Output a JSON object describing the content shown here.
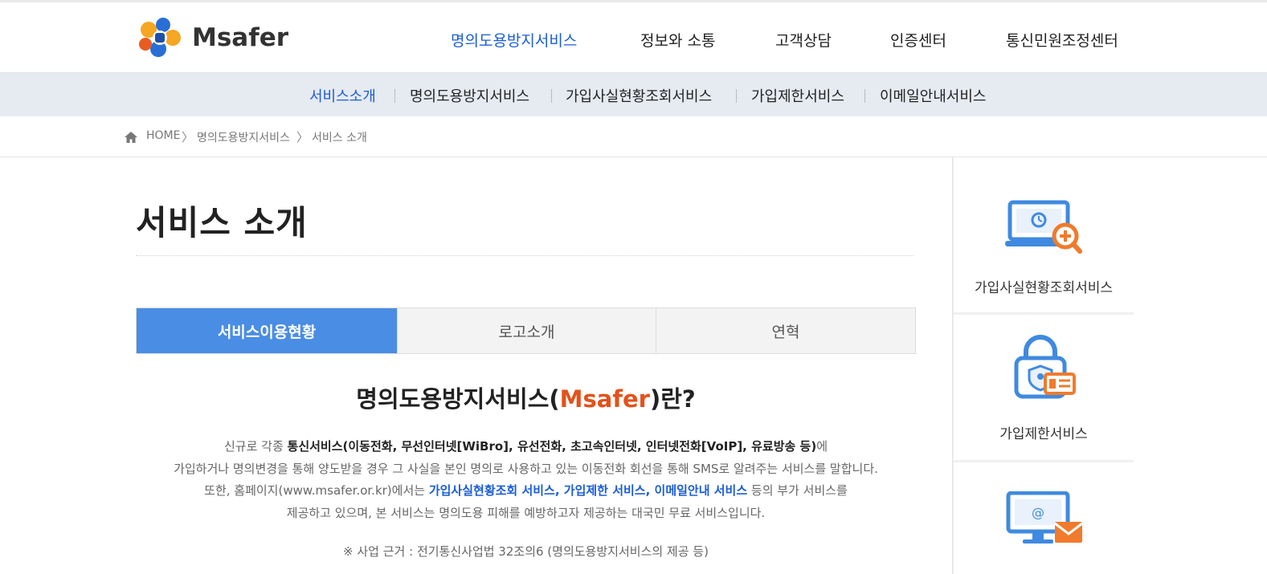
{
  "logo": {
    "text": "Msafer"
  },
  "gnb": [
    {
      "label": "명의도용방지서비스",
      "active": true
    },
    {
      "label": "정보와 소통",
      "active": false
    },
    {
      "label": "고객상담",
      "active": false
    },
    {
      "label": "인증센터",
      "active": false
    },
    {
      "label": "통신민원조정센터",
      "active": false
    }
  ],
  "subnav": [
    {
      "label": "서비스소개",
      "active": true
    },
    {
      "label": "명의도용방지서비스",
      "active": false
    },
    {
      "label": "가입사실현황조회서비스",
      "active": false
    },
    {
      "label": "가입제한서비스",
      "active": false
    },
    {
      "label": "이메일안내서비스",
      "active": false
    }
  ],
  "breadcrumb": {
    "home": "HOME",
    "items": [
      "명의도용방지서비스",
      "서비스 소개"
    ],
    "separator": "〉"
  },
  "page": {
    "title": "서비스 소개"
  },
  "tabs": [
    {
      "label": "서비스이용현황",
      "active": true
    },
    {
      "label": "로고소개",
      "active": false
    },
    {
      "label": "연혁",
      "active": false
    }
  ],
  "intro": {
    "title_before": "명의도용방지서비스(",
    "title_highlight": "Msafer",
    "title_after": ")란?",
    "line1_a": "신규로 각종 ",
    "line1_b": "통신서비스(이동전화, 무선인터넷[WiBro], 유선전화, 초고속인터넷, 인터넷전화[VoIP], 유료방송 등)",
    "line1_c": "에",
    "line2": "가입하거나 명의변경을 통해 양도받을 경우 그 사실을 본인 명의로 사용하고 있는 이동전화 회선을 통해 SMS로 알려주는 서비스를 말합니다.",
    "line3_a": "또한, 홈페이지(www.msafer.or.kr)에서는 ",
    "line3_b": "가입사실현황조회 서비스, 가입제한 서비스, 이메일안내 서비스",
    "line3_c": " 등의 부가 서비스를",
    "line4": "제공하고 있으며, 본 서비스는 명의도용 피해를 예방하고자 제공하는 대국민 무료 서비스입니다.",
    "note": "※ 사업 근거 : 전기통신사업법 32조의6 (명의도용방지서비스의 제공 등)"
  },
  "aside": [
    {
      "label": "가입사실현황조회서비스",
      "icon": "laptop-search-icon"
    },
    {
      "label": "가입제한서비스",
      "icon": "lock-id-card-icon"
    },
    {
      "label": "",
      "icon": "monitor-mail-icon"
    }
  ],
  "colors": {
    "brand_blue": "#1a5dd6",
    "tab_active": "#4a8de4",
    "highlight_orange": "#e2521b",
    "icon_blue": "#3f8ae0",
    "icon_orange": "#f07b2c"
  }
}
